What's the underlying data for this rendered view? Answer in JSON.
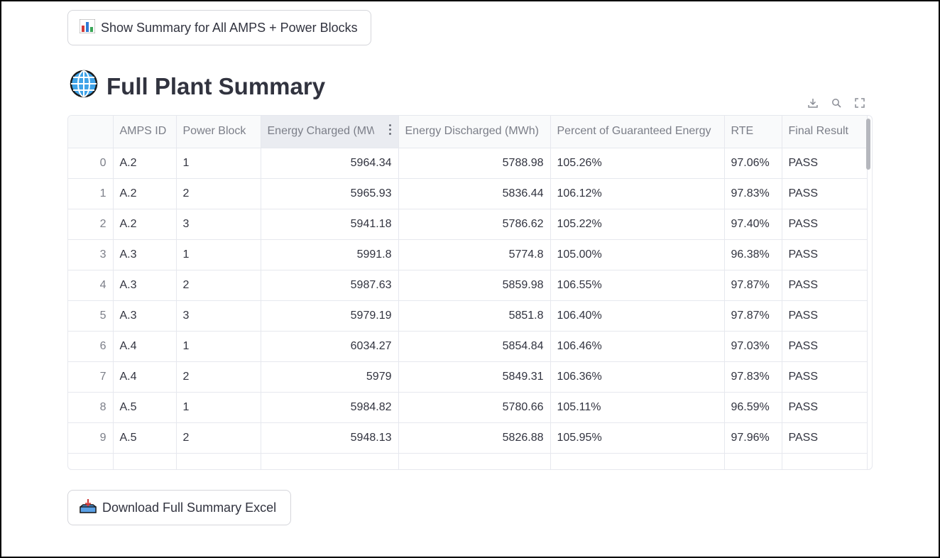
{
  "buttons": {
    "summary_label": "Show Summary for All AMPS + Power Blocks",
    "download_label": "Download Full Summary Excel"
  },
  "title": "Full Plant Summary",
  "icons": {
    "summary": "bar-chart-icon",
    "title": "globe-icon",
    "download": "inbox-tray-icon",
    "toolbar": [
      "download-icon",
      "search-icon",
      "fullscreen-icon"
    ]
  },
  "table": {
    "columns": [
      "",
      "AMPS ID",
      "Power Block",
      "Energy Charged (MWh)",
      "Energy Discharged (MWh)",
      "Percent of Guaranteed Energy",
      "RTE",
      "Final Result"
    ],
    "rows": [
      [
        "0",
        "A.2",
        "1",
        "5964.34",
        "5788.98",
        "105.26%",
        "97.06%",
        "PASS"
      ],
      [
        "1",
        "A.2",
        "2",
        "5965.93",
        "5836.44",
        "106.12%",
        "97.83%",
        "PASS"
      ],
      [
        "2",
        "A.2",
        "3",
        "5941.18",
        "5786.62",
        "105.22%",
        "97.40%",
        "PASS"
      ],
      [
        "3",
        "A.3",
        "1",
        "5991.8",
        "5774.8",
        "105.00%",
        "96.38%",
        "PASS"
      ],
      [
        "4",
        "A.3",
        "2",
        "5987.63",
        "5859.98",
        "106.55%",
        "97.87%",
        "PASS"
      ],
      [
        "5",
        "A.3",
        "3",
        "5979.19",
        "5851.8",
        "106.40%",
        "97.87%",
        "PASS"
      ],
      [
        "6",
        "A.4",
        "1",
        "6034.27",
        "5854.84",
        "106.46%",
        "97.03%",
        "PASS"
      ],
      [
        "7",
        "A.4",
        "2",
        "5979",
        "5849.31",
        "106.36%",
        "97.83%",
        "PASS"
      ],
      [
        "8",
        "A.5",
        "1",
        "5984.82",
        "5780.66",
        "105.11%",
        "96.59%",
        "PASS"
      ],
      [
        "9",
        "A.5",
        "2",
        "5948.13",
        "5826.88",
        "105.95%",
        "97.96%",
        "PASS"
      ],
      [
        "",
        "",
        "",
        "",
        "",
        "",
        "",
        ""
      ]
    ]
  }
}
